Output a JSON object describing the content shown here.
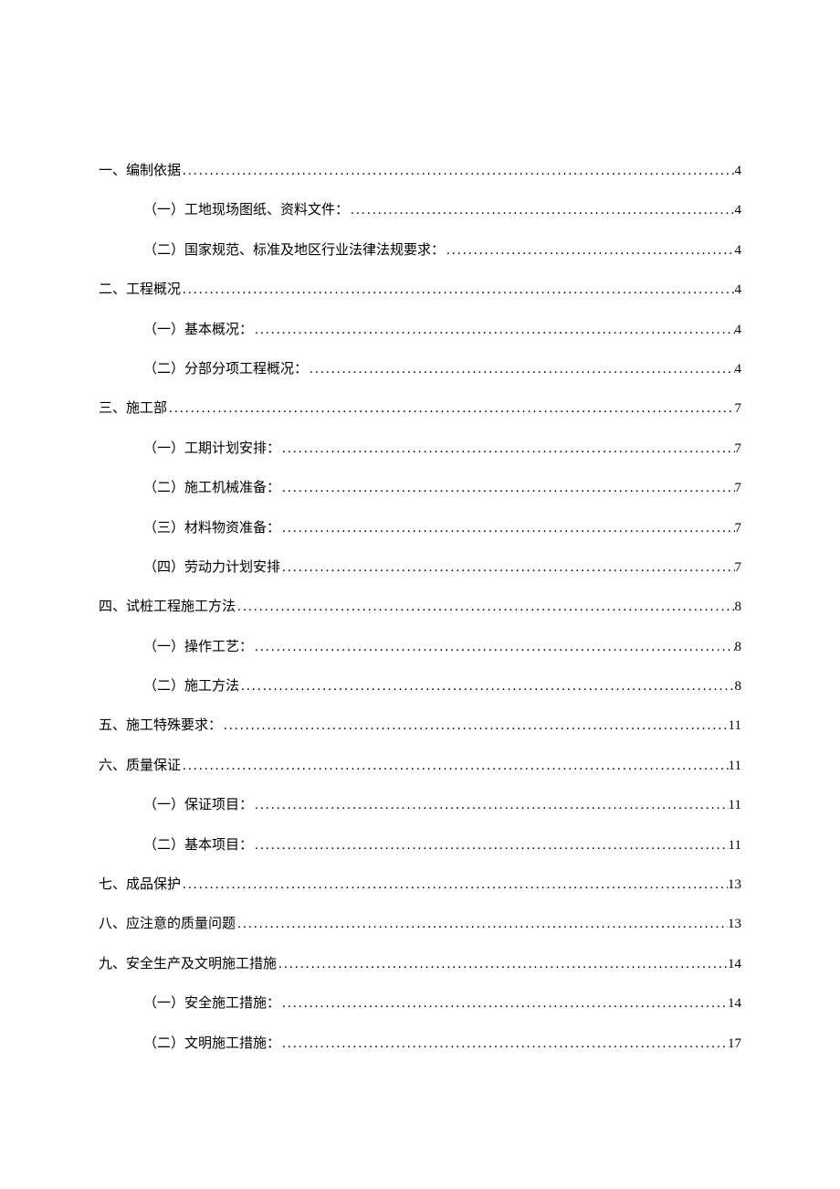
{
  "toc": [
    {
      "level": 1,
      "label": "一、编制依据",
      "page": "4"
    },
    {
      "level": 2,
      "label": "（一）工地现场图纸、资料文件：",
      "page": "4"
    },
    {
      "level": 2,
      "label": "（二）国家规范、标准及地区行业法律法规要求：",
      "page": "4"
    },
    {
      "level": 1,
      "label": "二、工程概况",
      "page": "4"
    },
    {
      "level": 2,
      "label": "（一）基本概况：",
      "page": "4"
    },
    {
      "level": 2,
      "label": "（二）分部分项工程概况：",
      "page": "4"
    },
    {
      "level": 1,
      "label": "三、施工部",
      "page": "7"
    },
    {
      "level": 2,
      "label": "（一）工期计划安排：",
      "page": "7"
    },
    {
      "level": 2,
      "label": "（二）施工机械准备：",
      "page": "7"
    },
    {
      "level": 2,
      "label": "（三）材料物资准备：",
      "page": "7"
    },
    {
      "level": 2,
      "label": "（四）劳动力计划安排",
      "page": "7"
    },
    {
      "level": 1,
      "label": "四、试桩工程施工方法",
      "page": "8"
    },
    {
      "level": 2,
      "label": "（一）操作工艺：",
      "page": "8"
    },
    {
      "level": 2,
      "label": "（二）施工方法",
      "page": "8"
    },
    {
      "level": 1,
      "label": "五、施工特殊要求：",
      "page": "11"
    },
    {
      "level": 1,
      "label": "六、质量保证",
      "page": "11"
    },
    {
      "level": 2,
      "label": "（一）保证项目：",
      "page": "11"
    },
    {
      "level": 2,
      "label": "（二）基本项目：",
      "page": "11"
    },
    {
      "level": 1,
      "label": "七、成品保护",
      "page": "13"
    },
    {
      "level": 1,
      "label": "八、应注意的质量问题",
      "page": "13"
    },
    {
      "level": 1,
      "label": "九、安全生产及文明施工措施",
      "page": "14"
    },
    {
      "level": 2,
      "label": "（一）安全施工措施：",
      "page": "14"
    },
    {
      "level": 2,
      "label": "（二）文明施工措施：",
      "page": "17"
    }
  ]
}
